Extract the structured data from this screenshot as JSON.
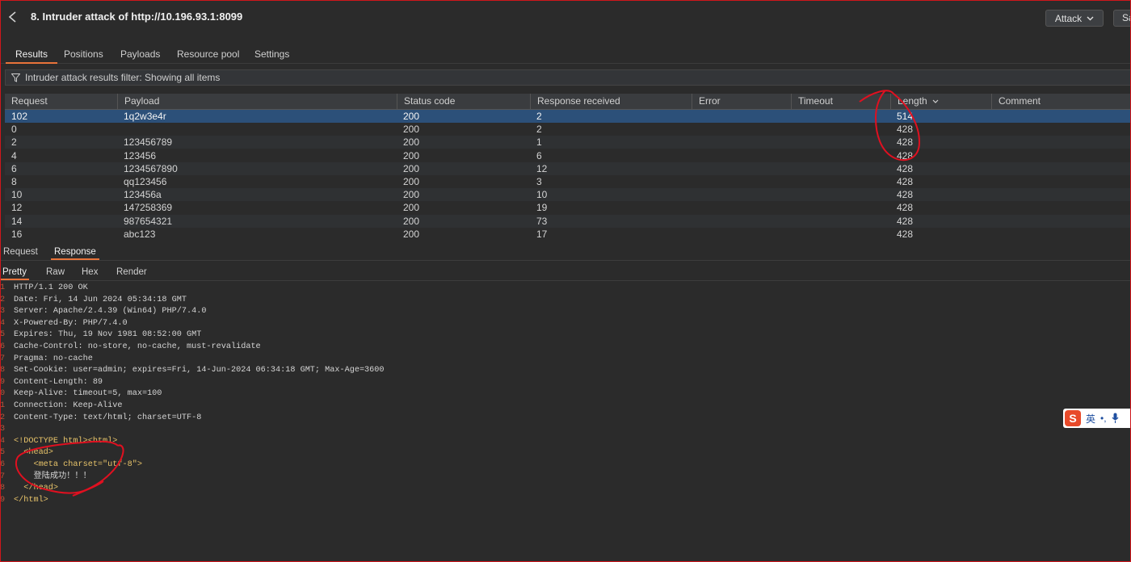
{
  "window": {
    "title": "8. Intruder attack of http://10.196.93.1:8099"
  },
  "toolbar": {
    "attack_label": "Attack",
    "save_label": "Sa"
  },
  "tabs": [
    "Results",
    "Positions",
    "Payloads",
    "Resource pool",
    "Settings"
  ],
  "filter": {
    "text": "Intruder attack results filter: Showing all items"
  },
  "table": {
    "columns": [
      "Request",
      "Payload",
      "Status code",
      "Response received",
      "Error",
      "Timeout",
      "Length",
      "Comment"
    ],
    "sort_column": "Length",
    "rows": [
      {
        "request": "102",
        "payload": "1q2w3e4r",
        "status": "200",
        "received": "2",
        "length": "514"
      },
      {
        "request": "0",
        "payload": "",
        "status": "200",
        "received": "2",
        "length": "428"
      },
      {
        "request": "2",
        "payload": "123456789",
        "status": "200",
        "received": "1",
        "length": "428"
      },
      {
        "request": "4",
        "payload": "123456",
        "status": "200",
        "received": "6",
        "length": "428"
      },
      {
        "request": "6",
        "payload": "1234567890",
        "status": "200",
        "received": "12",
        "length": "428"
      },
      {
        "request": "8",
        "payload": "qq123456",
        "status": "200",
        "received": "3",
        "length": "428"
      },
      {
        "request": "10",
        "payload": "123456a",
        "status": "200",
        "received": "10",
        "length": "428"
      },
      {
        "request": "12",
        "payload": "147258369",
        "status": "200",
        "received": "19",
        "length": "428"
      },
      {
        "request": "14",
        "payload": "987654321",
        "status": "200",
        "received": "73",
        "length": "428"
      },
      {
        "request": "16",
        "payload": "abc123",
        "status": "200",
        "received": "17",
        "length": "428"
      }
    ]
  },
  "message_tabs": [
    "Request",
    "Response"
  ],
  "view_tabs": [
    "Pretty",
    "Raw",
    "Hex",
    "Render"
  ],
  "response": {
    "gutter": [
      "1",
      "2",
      "3",
      "4",
      "5",
      "6",
      "7",
      "8",
      "9",
      "0",
      "1",
      "2",
      "3",
      "4",
      "5",
      "6",
      "7",
      "8",
      "9"
    ],
    "lines": [
      "HTTP/1.1 200 OK",
      "Date: Fri, 14 Jun 2024 05:34:18 GMT",
      "Server: Apache/2.4.39 (Win64) PHP/7.4.0",
      "X-Powered-By: PHP/7.4.0",
      "Expires: Thu, 19 Nov 1981 08:52:00 GMT",
      "Cache-Control: no-store, no-cache, must-revalidate",
      "Pragma: no-cache",
      "Set-Cookie: user=admin; expires=Fri, 14-Jun-2024 06:34:18 GMT; Max-Age=3600",
      "Content-Length: 89",
      "Keep-Alive: timeout=5, max=100",
      "Connection: Keep-Alive",
      "Content-Type: text/html; charset=UTF-8",
      "",
      "<!DOCTYPE html><html>",
      "  <head>",
      "    <meta charset=\"utf-8\">",
      "    登陆成功！！！",
      "  </head>",
      "</html>"
    ]
  },
  "ime": {
    "logo": "S",
    "lang": "英",
    "punct": "•,"
  },
  "colors": {
    "accent": "#e8733a",
    "selected_row": "#2c5079",
    "annotation": "#e01020"
  }
}
